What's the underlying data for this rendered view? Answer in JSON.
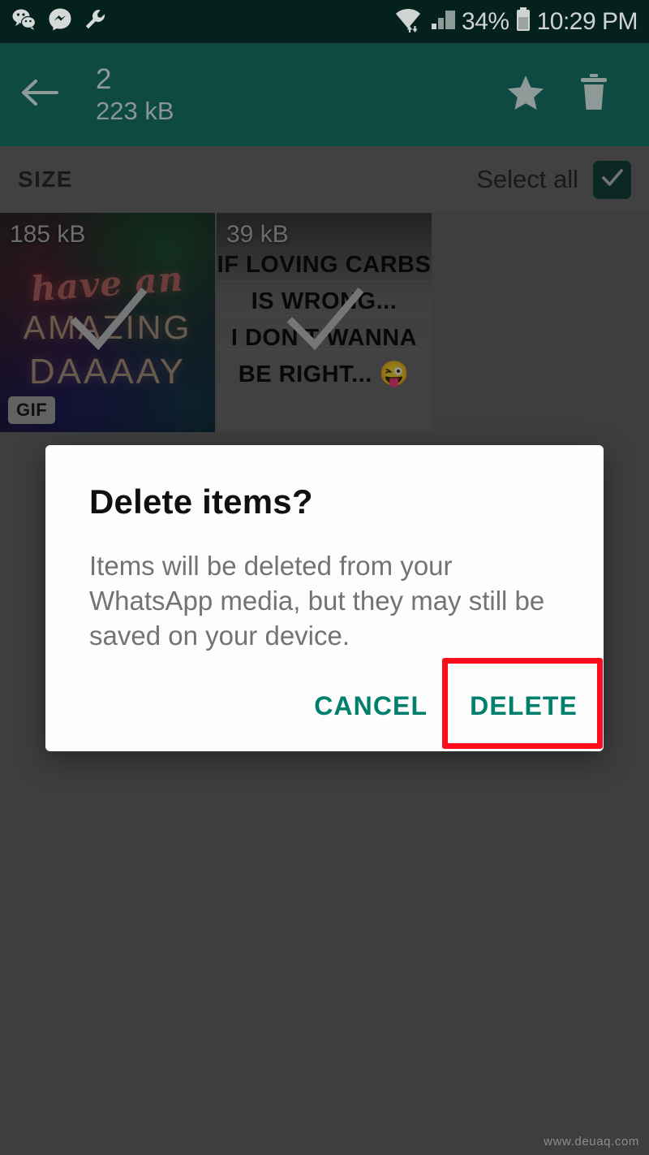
{
  "status_bar": {
    "time": "10:29 PM",
    "battery_percent": "34%",
    "left_icons": [
      "wechat-icon",
      "messenger-icon",
      "wrench-icon"
    ],
    "right_icons": [
      "wifi-icon",
      "cellular-signal-icon",
      "battery-icon"
    ],
    "background_color": "#05211d",
    "text_color": "#cfd4d2"
  },
  "app_bar": {
    "back_icon": "back-arrow-icon",
    "selected_count": "2",
    "selected_size": "223 kB",
    "star_icon": "star-icon",
    "delete_icon": "trash-icon",
    "background_color": "#0f4a42"
  },
  "size_bar": {
    "section_label": "SIZE",
    "select_all_label": "Select all",
    "select_all_checked": true,
    "checkbox_color": "#14463e"
  },
  "grid": {
    "items": [
      {
        "size": "185 kB",
        "badge": "GIF",
        "selected": true,
        "caption_script": "have an",
        "caption_line2": "AMAZING",
        "caption_line3": "DAAAAY"
      },
      {
        "size": "39 kB",
        "badge": "",
        "selected": true,
        "lines": [
          "IF LOVING CARBS",
          "IS WRONG...",
          "I DON'T WANNA",
          "BE RIGHT..."
        ],
        "emoji": "😜"
      }
    ]
  },
  "dialog": {
    "title": "Delete items?",
    "body": "Items will be deleted from your WhatsApp media, but they may still be saved on your device.",
    "cancel_label": "CANCEL",
    "delete_label": "DELETE",
    "action_color": "#00806c",
    "highlight_color": "#fc0d1b"
  },
  "watermark": "www.deuaq.com"
}
